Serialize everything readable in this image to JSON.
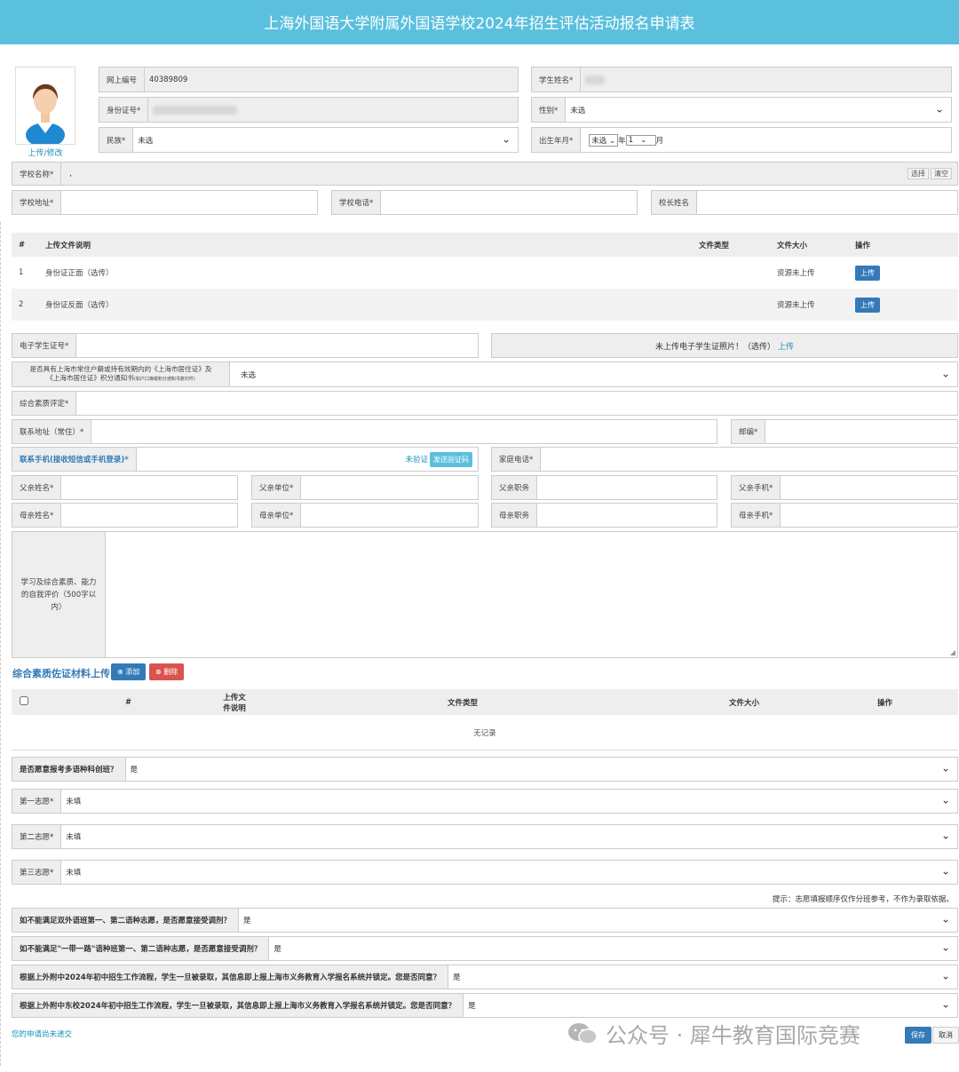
{
  "header": {
    "title": "上海外国语大学附属外国语学校2024年招生评估活动报名申请表"
  },
  "avatar": {
    "upload_link": "上传/修改"
  },
  "fields": {
    "online_no": {
      "label": "网上编号",
      "value": "40389809"
    },
    "student_name": {
      "label": "学生姓名*"
    },
    "id_card": {
      "label": "身份证号*"
    },
    "gender": {
      "label": "性别*",
      "value": "未选"
    },
    "ethnicity": {
      "label": "民族*",
      "value": "未选"
    },
    "birth": {
      "label": "出生年月*",
      "year": "未选",
      "year_unit": "年",
      "month": "1",
      "month_unit": "月"
    },
    "school_name": {
      "label": "学校名称*",
      "value": ",",
      "select_btn": "选择",
      "clear_btn": "清空"
    },
    "school_addr": {
      "label": "学校地址*"
    },
    "school_phone": {
      "label": "学校电话*"
    },
    "principal": {
      "label": "校长姓名"
    }
  },
  "files_table": {
    "headers": [
      "#",
      "上传文件说明",
      "文件类型",
      "文件大小",
      "操作"
    ],
    "rows": [
      {
        "no": "1",
        "desc": "身份证正面（选传）",
        "size": "资源未上传",
        "action": "上传"
      },
      {
        "no": "2",
        "desc": "身份证反面（选传）",
        "size": "资源未上传",
        "action": "上传"
      }
    ]
  },
  "student_card": {
    "label": "电子学生证号*",
    "photo_text": "未上传电子学生证照片！（选传）",
    "upload_link": "上传"
  },
  "residence": {
    "label_line1": "是否具有上海市常住户籍或持有效期内的《上海市居住证》及",
    "label_line2": "《上海市居住证》积分通知书",
    "label_small": "(如户口簿或积分通知书复印件)",
    "value": "未选"
  },
  "quality": {
    "label": "综合素质评定*"
  },
  "address": {
    "label": "联系地址（常住）*"
  },
  "postcode": {
    "label": "邮编*"
  },
  "mobile": {
    "label": "联系手机(接收短信或手机登录)*",
    "status": "未验证",
    "send_btn": "发送验证码"
  },
  "home_phone": {
    "label": "家庭电话*"
  },
  "father": {
    "name": "父亲姓名*",
    "unit": "父亲单位*",
    "job": "父亲职务",
    "phone": "父亲手机*"
  },
  "mother": {
    "name": "母亲姓名*",
    "unit": "母亲单位*",
    "job": "母亲职务",
    "phone": "母亲手机*"
  },
  "self_eval": {
    "label": "学习及综合素质、能力的自我评价（500字以内）"
  },
  "materials": {
    "title": "综合素质佐证材料上传",
    "add_btn": "添加",
    "del_btn": "删除",
    "headers": [
      "#",
      "上传文件说明",
      "文件类型",
      "文件大小",
      "操作"
    ],
    "empty": "无记录"
  },
  "questions": {
    "multi_lang": {
      "label": "是否愿意报考多语种科创班？",
      "value": "是"
    },
    "choice1": {
      "label": "第一志愿*",
      "value": "未填"
    },
    "choice2": {
      "label": "第二志愿*",
      "value": "未填"
    },
    "choice3": {
      "label": "第三志愿*",
      "value": "未填"
    },
    "hint": "提示：志愿填报顺序仅作分班参考，不作为录取依据。",
    "adjust1": {
      "label": "如不能满足双外语班第一、第二语种志愿，是否愿意接受调剂？",
      "value": "是"
    },
    "adjust2": {
      "label": "如不能满足\"一带一路\"语种班第一、第二语种志愿，是否愿意接受调剂？",
      "value": "是"
    },
    "agree1": {
      "label": "根据上外附中2024年初中招生工作流程，学生一旦被录取，其信息即上报上海市义务教育入学报名系统并锁定。您是否同意？",
      "value": "是"
    },
    "agree2": {
      "label": "根据上外附中东校2024年初中招生工作流程，学生一旦被录取，其信息即上报上海市义务教育入学报名系统并锁定。您是否同意？",
      "value": "是"
    }
  },
  "footer": {
    "status": "您的申请尚未递交",
    "watermark": "公众号 · 犀牛教育国际竞赛",
    "save_btn": "保存",
    "cancel_btn": "取消"
  }
}
